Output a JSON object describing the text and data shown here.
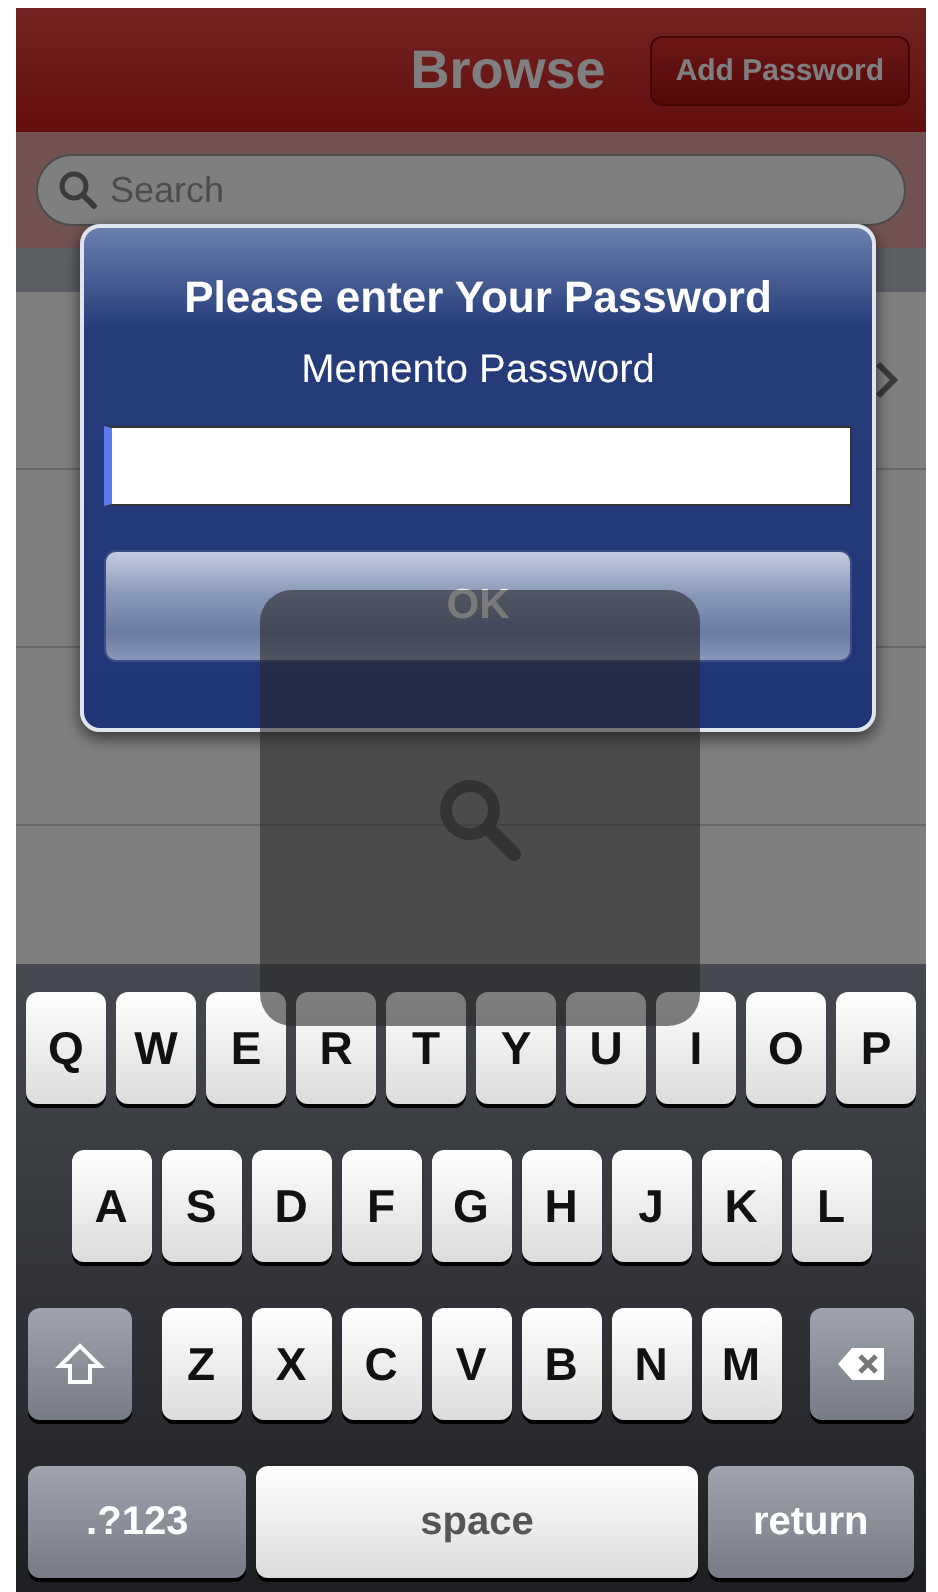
{
  "nav_bar": {
    "title": "Browse",
    "button": "Add Password"
  },
  "search": {
    "placeholder": "Search"
  },
  "list": {
    "rows": [
      {
        "kind": "entry"
      },
      {
        "kind": "blank"
      },
      {
        "kind": "blank"
      },
      {
        "kind": "blank"
      }
    ]
  },
  "alert": {
    "title": "Please enter Your Password",
    "message": "Memento Password",
    "button": "OK"
  },
  "keyboard": {
    "rows": [
      {
        "keys": [
          {
            "kind": "letter",
            "label": "Q"
          },
          {
            "kind": "letter",
            "label": "W"
          },
          {
            "kind": "letter",
            "label": "E"
          },
          {
            "kind": "letter",
            "label": "R"
          },
          {
            "kind": "letter",
            "label": "T"
          },
          {
            "kind": "letter",
            "label": "Y"
          },
          {
            "kind": "letter",
            "label": "U"
          },
          {
            "kind": "letter",
            "label": "I"
          },
          {
            "kind": "letter",
            "label": "O"
          },
          {
            "kind": "letter",
            "label": "P"
          }
        ]
      },
      {
        "keys": [
          {
            "kind": "letter",
            "label": "A"
          },
          {
            "kind": "letter",
            "label": "S"
          },
          {
            "kind": "letter",
            "label": "D"
          },
          {
            "kind": "letter",
            "label": "F"
          },
          {
            "kind": "letter",
            "label": "G"
          },
          {
            "kind": "letter",
            "label": "H"
          },
          {
            "kind": "letter",
            "label": "J"
          },
          {
            "kind": "letter",
            "label": "K"
          },
          {
            "kind": "letter",
            "label": "L"
          }
        ]
      },
      {
        "keys": [
          {
            "kind": "shift"
          },
          {
            "kind": "letter",
            "label": "Z"
          },
          {
            "kind": "letter",
            "label": "X"
          },
          {
            "kind": "letter",
            "label": "C"
          },
          {
            "kind": "letter",
            "label": "V"
          },
          {
            "kind": "letter",
            "label": "B"
          },
          {
            "kind": "letter",
            "label": "N"
          },
          {
            "kind": "letter",
            "label": "M"
          },
          {
            "kind": "delete"
          }
        ]
      },
      {
        "keys": [
          {
            "kind": "mode",
            "label": ".?123"
          },
          {
            "kind": "space",
            "label": "space"
          },
          {
            "kind": "return",
            "label": "return"
          }
        ]
      }
    ]
  }
}
